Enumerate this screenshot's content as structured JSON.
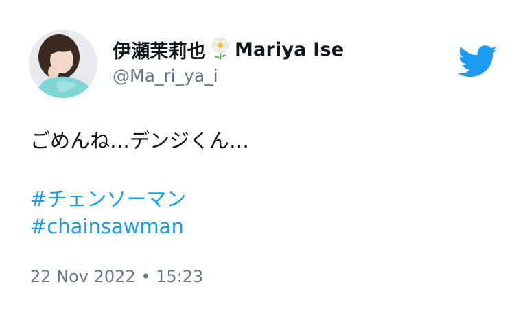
{
  "author": {
    "display_name": "伊瀬茉莉也",
    "display_name_latin": "Mariya Ise",
    "handle": "@Ma_ri_ya_i",
    "name_emoji_icon": "white-flower-icon"
  },
  "platform_icon": "twitter-bird-icon",
  "tweet": {
    "text": "ごめんね…デンジくん…",
    "hashtags": [
      "#チェンソーマン",
      "#chainsawman"
    ],
    "timestamp": "22 Nov 2022 • 15:23"
  },
  "colors": {
    "link": "#1d9bf0",
    "twitter_blue": "#1d9bf0",
    "text": "#0f1419",
    "secondary_text": "#687684"
  }
}
